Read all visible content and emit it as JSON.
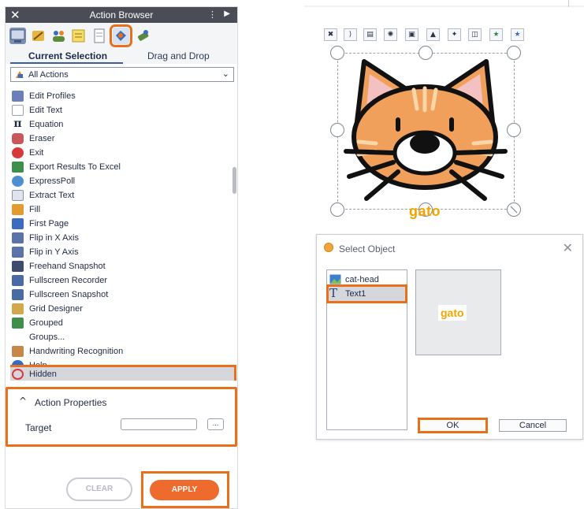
{
  "panel": {
    "title": "Action Browser",
    "close_glyph": "✕",
    "menu_glyph": "⋮",
    "pin_glyph": "▶",
    "toolbar_icons": [
      "display-icon",
      "tools-icon",
      "people-icon",
      "notes-icon",
      "document-icon",
      "pen-action-icon",
      "eraser-action-icon"
    ],
    "selected_toolbar_icon": "pen-action-icon",
    "tabs": {
      "current": "Current Selection",
      "drag": "Drag and Drop"
    },
    "filter": {
      "value": "All Actions"
    },
    "actions": [
      "Edit Profiles",
      "Edit Text",
      "Equation",
      "Eraser",
      "Exit",
      "Export Results To Excel",
      "ExpressPoll",
      "Extract Text",
      "Fill",
      "First Page",
      "Flip in X Axis",
      "Flip in Y Axis",
      "Freehand Snapshot",
      "Fullscreen Recorder",
      "Fullscreen Snapshot",
      "Grid Designer",
      "Grouped",
      "Groups...",
      "Handwriting Recognition",
      "Help",
      "Hidden"
    ],
    "selected_action": "Hidden",
    "properties": {
      "chevron": "^",
      "title": "Action Properties",
      "target_label": "Target",
      "target_value": "",
      "browse_label": "..."
    },
    "buttons": {
      "clear": "CLEAR",
      "apply": "APPLY"
    }
  },
  "canvas": {
    "mini_toolbar": [
      "✖",
      "⟩",
      "▤",
      "✺",
      "▣",
      "▲",
      "✦",
      "◫",
      "★",
      "★"
    ],
    "object_label": "gato",
    "colors": {
      "label": "#f5a300",
      "cat_fur": "#f0a05a",
      "highlight": "#e8701a"
    }
  },
  "dialog": {
    "title": "Select Object",
    "close_glyph": "✕",
    "objects": [
      "cat-head",
      "Text1"
    ],
    "selected_object": "Text1",
    "preview_text": "gato",
    "ok": "OK",
    "cancel": "Cancel"
  }
}
